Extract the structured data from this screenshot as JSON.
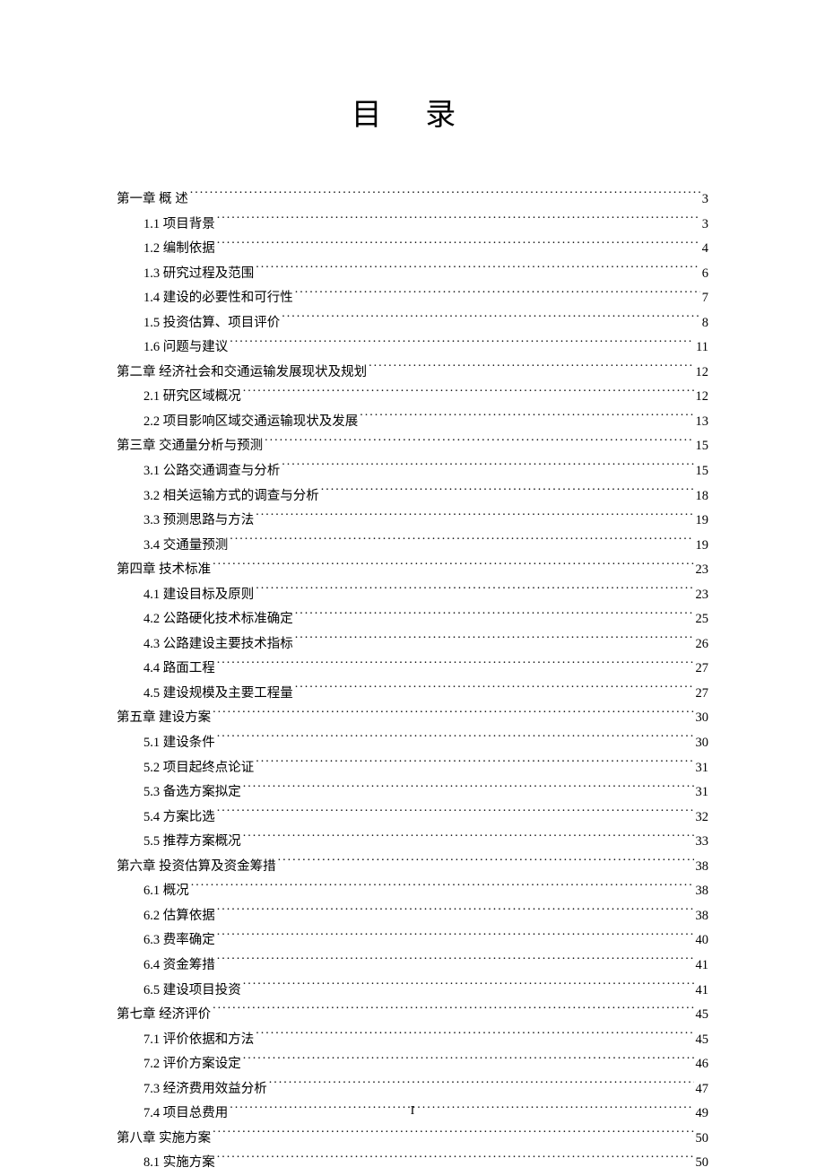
{
  "title": "目 录",
  "page_number": "I",
  "toc": [
    {
      "level": 1,
      "label": "第一章 概 述",
      "page": "3"
    },
    {
      "level": 2,
      "label": "1.1 项目背景",
      "page": "3"
    },
    {
      "level": 2,
      "label": "1.2 编制依据",
      "page": "4"
    },
    {
      "level": 2,
      "label": "1.3 研究过程及范围",
      "page": "6"
    },
    {
      "level": 2,
      "label": "1.4 建设的必要性和可行性",
      "page": "7"
    },
    {
      "level": 2,
      "label": "1.5 投资估算、项目评价",
      "page": "8"
    },
    {
      "level": 2,
      "label": "1.6 问题与建议",
      "page": "11"
    },
    {
      "level": 1,
      "label": "第二章 经济社会和交通运输发展现状及规划",
      "page": "12"
    },
    {
      "level": 2,
      "label": "2.1 研究区域概况",
      "page": "12"
    },
    {
      "level": 2,
      "label": "2.2 项目影响区域交通运输现状及发展",
      "page": "13"
    },
    {
      "level": 1,
      "label": "第三章 交通量分析与预测",
      "page": "15"
    },
    {
      "level": 2,
      "label": "3.1 公路交通调查与分析",
      "page": "15"
    },
    {
      "level": 2,
      "label": "3.2 相关运输方式的调查与分析",
      "page": "18"
    },
    {
      "level": 2,
      "label": "3.3 预测思路与方法",
      "page": "19"
    },
    {
      "level": 2,
      "label": "3.4 交通量预测",
      "page": "19"
    },
    {
      "level": 1,
      "label": "第四章 技术标准",
      "page": "23"
    },
    {
      "level": 2,
      "label": "4.1 建设目标及原则",
      "page": "23"
    },
    {
      "level": 2,
      "label": "4.2 公路硬化技术标准确定",
      "page": "25"
    },
    {
      "level": 2,
      "label": "4.3 公路建设主要技术指标",
      "page": "26"
    },
    {
      "level": 2,
      "label": "4.4 路面工程",
      "page": "27"
    },
    {
      "level": 2,
      "label": "4.5 建设规模及主要工程量",
      "page": "27"
    },
    {
      "level": 1,
      "label": "第五章 建设方案",
      "page": "30"
    },
    {
      "level": 2,
      "label": "5.1 建设条件",
      "page": "30"
    },
    {
      "level": 2,
      "label": "5.2 项目起终点论证",
      "page": "31"
    },
    {
      "level": 2,
      "label": "5.3 备选方案拟定",
      "page": "31"
    },
    {
      "level": 2,
      "label": "5.4 方案比选",
      "page": "32"
    },
    {
      "level": 2,
      "label": "5.5 推荐方案概况",
      "page": "33"
    },
    {
      "level": 1,
      "label": "第六章 投资估算及资金筹措",
      "page": "38"
    },
    {
      "level": 2,
      "label": "6.1 概况",
      "page": "38"
    },
    {
      "level": 2,
      "label": "6.2 估算依据",
      "page": "38"
    },
    {
      "level": 2,
      "label": "6.3 费率确定",
      "page": "40"
    },
    {
      "level": 2,
      "label": "6.4 资金筹措",
      "page": "41"
    },
    {
      "level": 2,
      "label": "6.5 建设项目投资",
      "page": "41"
    },
    {
      "level": 1,
      "label": "第七章  经济评价",
      "page": "45"
    },
    {
      "level": 2,
      "label": "7.1 评价依据和方法",
      "page": "45"
    },
    {
      "level": 2,
      "label": "7.2 评价方案设定",
      "page": "46"
    },
    {
      "level": 2,
      "label": "7.3 经济费用效益分析",
      "page": "47"
    },
    {
      "level": 2,
      "label": "7.4 项目总费用",
      "page": "49"
    },
    {
      "level": 1,
      "label": "第八章  实施方案",
      "page": "50"
    },
    {
      "level": 2,
      "label": "8.1 实施方案",
      "page": "50"
    }
  ]
}
